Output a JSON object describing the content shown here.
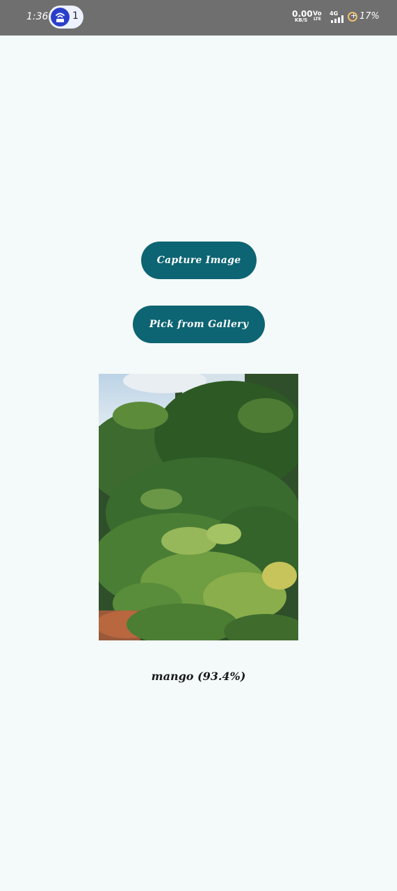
{
  "status_bar": {
    "time": "1:36",
    "hotspot_count": "1",
    "net_speed_value": "0.00",
    "net_speed_unit": "KB/S",
    "volte_top": "Vo",
    "volte_bottom": "LTE",
    "network_type": "4G",
    "battery_percent": "17%"
  },
  "actions": {
    "capture_label": "Capture Image",
    "gallery_label": "Pick from Gallery"
  },
  "result": {
    "prediction": "mango (93.4%)"
  },
  "colors": {
    "background": "#f4f9f9",
    "button": "#0d6472",
    "status_bar": "#6f6f6f"
  },
  "icons": {
    "hotspot": "hotspot-icon",
    "signal": "signal-icon",
    "battery": "battery-saver-icon"
  }
}
